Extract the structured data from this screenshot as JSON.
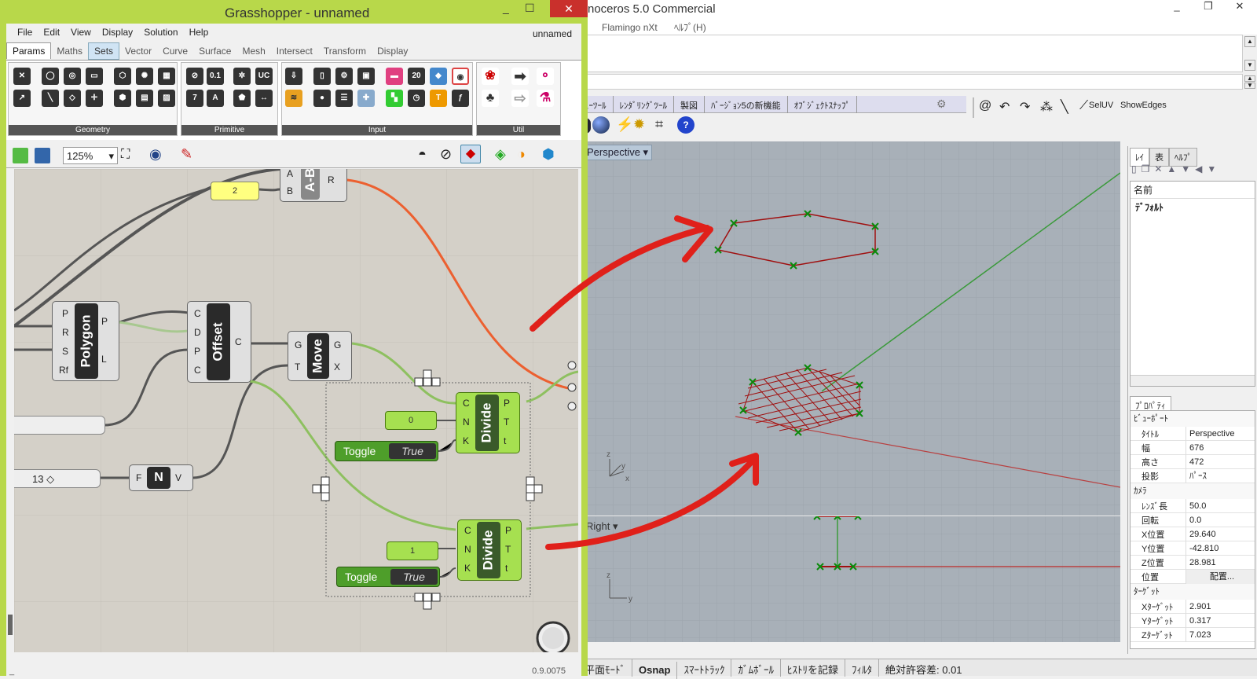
{
  "grasshopper": {
    "title": "Grasshopper - unnamed",
    "menu": [
      "File",
      "Edit",
      "View",
      "Display",
      "Solution",
      "Help"
    ],
    "document_name": "unnamed",
    "tabs": [
      "Params",
      "Maths",
      "Sets",
      "Vector",
      "Curve",
      "Surface",
      "Mesh",
      "Intersect",
      "Transform",
      "Display"
    ],
    "ribbon_groups": [
      "Geometry",
      "Primitive",
      "Input",
      "Util"
    ],
    "zoom": "125%",
    "version": "0.9.0075",
    "canvas": {
      "panel_value": "2",
      "subtract_component": {
        "label": "A-B",
        "inputs": [
          "A",
          "B"
        ],
        "outputs": [
          "R"
        ]
      },
      "polygon": {
        "label": "Polygon",
        "inputs": [
          "P",
          "R",
          "S",
          "Rf"
        ],
        "outputs": [
          "P",
          "L"
        ]
      },
      "offset": {
        "label": "Offset",
        "inputs": [
          "C",
          "D",
          "P",
          "C"
        ],
        "outputs": [
          "C"
        ]
      },
      "move": {
        "label": "Move",
        "inputs": [
          "G",
          "T"
        ],
        "outputs": [
          "G",
          "X"
        ]
      },
      "divide1": {
        "label": "Divide",
        "inputs": [
          "C",
          "N",
          "K"
        ],
        "outputs": [
          "P",
          "T",
          "t"
        ]
      },
      "divide2": {
        "label": "Divide",
        "inputs": [
          "C",
          "N",
          "K"
        ],
        "outputs": [
          "P",
          "T",
          "t"
        ]
      },
      "number_panel_1": "0",
      "number_panel_2": "1",
      "toggle_label": "Toggle",
      "toggle_value": "True",
      "slider_value": "13 ◇",
      "unit_z": {
        "label": "N",
        "inputs": [
          "F"
        ],
        "outputs": [
          "V"
        ]
      }
    }
  },
  "rhino": {
    "title": "noceros 5.0 Commercial",
    "menu": [
      "Flamingo nXt",
      "ﾍﾙﾌﾟ(H)"
    ],
    "toolbar_tabs": [
      "ｭｰﾂｰﾙ",
      "ﾚﾝﾀﾞﾘﾝｸﾞﾂｰﾙ",
      "製図",
      "ﾊﾞｰｼﾞｮﾝ5の新機能",
      "ｵﾌﾞｼﾞｪｸﾄｽﾅｯﾌﾟ"
    ],
    "tool_labels": [
      "SelUV",
      "ShowEdges"
    ],
    "viewport_perspective": "Perspective",
    "viewport_right": "Right",
    "panel_tabs": [
      "ﾚｲ",
      "表",
      "ﾍﾙﾌﾟ"
    ],
    "layers_header": "名前",
    "layer_default": "ﾃﾞﾌｫﾙﾄ",
    "props_tab": "ﾌﾟﾛﾊﾟﾃｨ",
    "props": {
      "section_viewport": "ﾋﾞｭｰﾎﾟｰﾄ",
      "rows_viewport": [
        {
          "k": "ﾀｲﾄﾙ",
          "v": "Perspective"
        },
        {
          "k": "幅",
          "v": "676"
        },
        {
          "k": "高さ",
          "v": "472"
        },
        {
          "k": "投影",
          "v": "ﾊﾟｰｽ"
        }
      ],
      "section_camera": "ｶﾒﾗ",
      "rows_camera": [
        {
          "k": "ﾚﾝｽﾞ長",
          "v": "50.0"
        },
        {
          "k": "回転",
          "v": "0.0"
        },
        {
          "k": "X位置",
          "v": "29.640"
        },
        {
          "k": "Y位置",
          "v": "-42.810"
        },
        {
          "k": "Z位置",
          "v": "28.981"
        },
        {
          "k": "位置",
          "v": "配置..."
        }
      ],
      "section_target": "ﾀｰｹﾞｯﾄ",
      "rows_target": [
        {
          "k": "Xﾀｰｹﾞｯﾄ",
          "v": "2.901"
        },
        {
          "k": "Yﾀｰｹﾞｯﾄ",
          "v": "0.317"
        },
        {
          "k": "Zﾀｰｹﾞｯﾄ",
          "v": "7.023"
        }
      ]
    },
    "status": [
      "平面ﾓｰﾄﾞ",
      "Osnap",
      "ｽﾏｰﾄﾄﾗｯｸ",
      "ｶﾞﾑﾎﾞｰﾙ",
      "ﾋｽﾄﾘを記録",
      "ﾌｨﾙﾀ",
      "絶対許容差: 0.01"
    ]
  },
  "colors": {
    "accent_red": "#e0201a",
    "gh_green": "#a6e050",
    "gh_frame": "#b8d84a"
  }
}
